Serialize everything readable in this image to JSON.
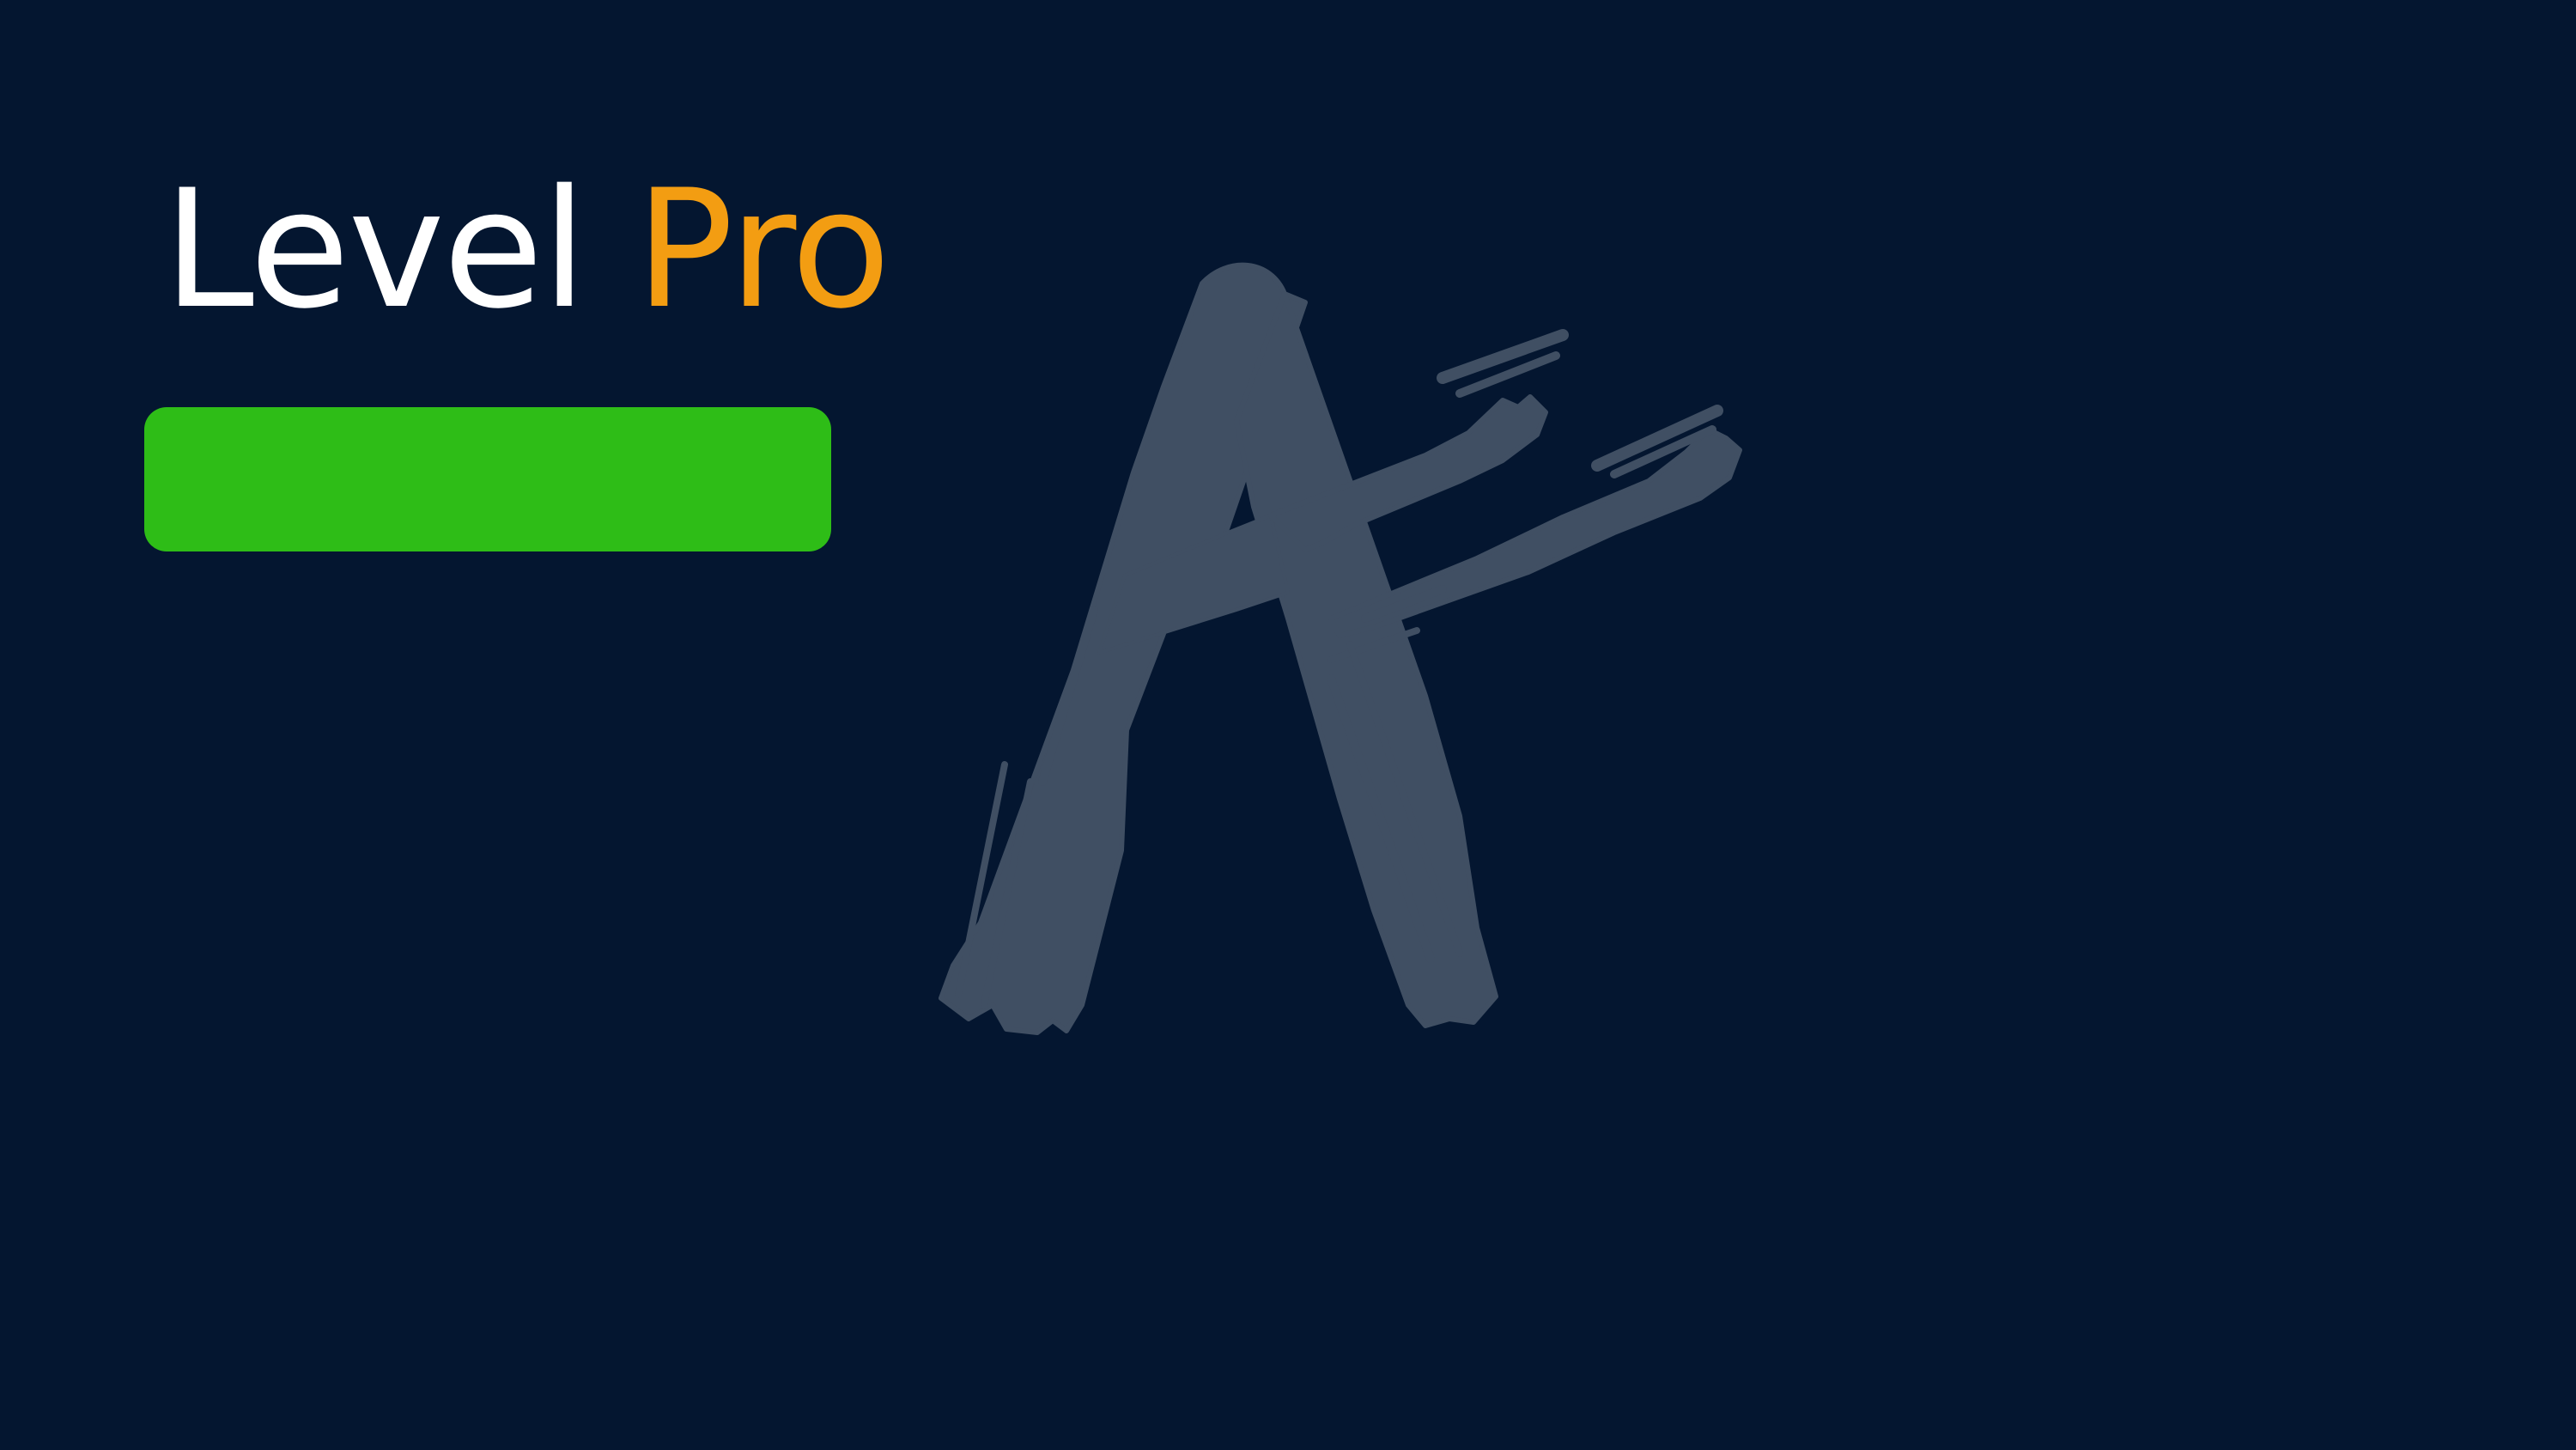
{
  "title": {
    "word_1": "Level",
    "word_2": "Pro"
  },
  "colors": {
    "background": "#041630",
    "title_primary": "#ffffff",
    "title_accent": "#f39d12",
    "level_bar": "#2ebd17",
    "logo_mark": "#404f63"
  },
  "logo": {
    "icon": "brush-stroke-a-logo"
  }
}
